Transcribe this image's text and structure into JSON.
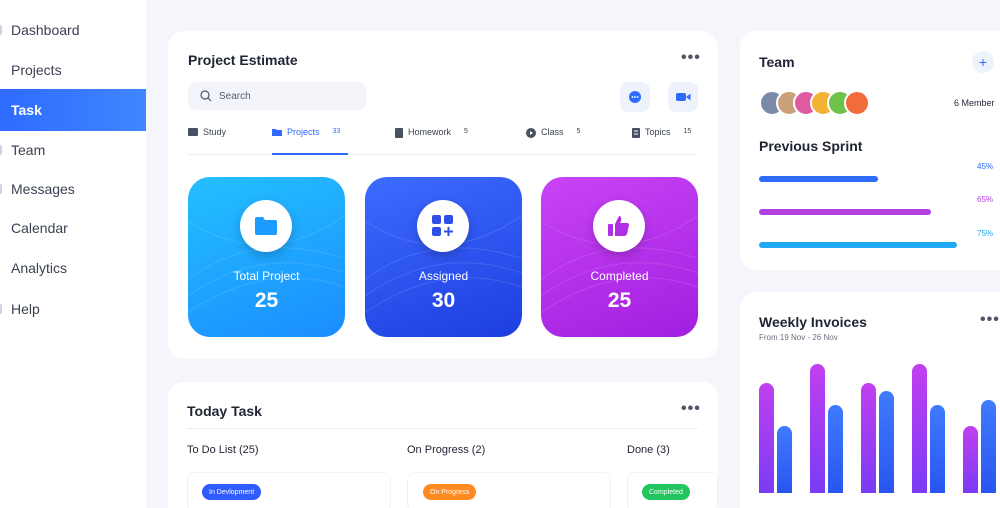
{
  "sidebar": {
    "items": [
      {
        "label": "Dashboard",
        "active": false
      },
      {
        "label": "Projects",
        "active": false
      },
      {
        "label": "Task",
        "active": true
      },
      {
        "label": "Team",
        "active": false
      },
      {
        "label": "Messages",
        "active": false
      },
      {
        "label": "Calendar",
        "active": false
      },
      {
        "label": "Analytics",
        "active": false
      },
      {
        "label": "Help",
        "active": false
      }
    ]
  },
  "project_estimate": {
    "title": "Project Estimate",
    "search_placeholder": "Search",
    "tabs": [
      {
        "label": "Study",
        "count": "",
        "icon": "book-icon"
      },
      {
        "label": "Projects",
        "count": "33",
        "icon": "folder-icon",
        "active": true
      },
      {
        "label": "Homework",
        "count": "5",
        "icon": "document-icon"
      },
      {
        "label": "Class",
        "count": "5",
        "icon": "play-icon"
      },
      {
        "label": "Topics",
        "count": "15",
        "icon": "list-icon"
      }
    ],
    "stats": [
      {
        "label": "Total Project",
        "value": "25",
        "icon": "folder-icon",
        "color_from": "#1fb6ff",
        "color_to": "#1a8dff"
      },
      {
        "label": "Assigned",
        "value": "30",
        "icon": "apps-add-icon",
        "color_from": "#3a63ff",
        "color_to": "#1f3fe0"
      },
      {
        "label": "Completed",
        "value": "25",
        "icon": "thumbs-up-icon",
        "color_from": "#c03cf2",
        "color_to": "#a21fe0"
      }
    ]
  },
  "today_task": {
    "title": "Today Task",
    "columns": [
      {
        "label": "To Do List (25)",
        "badge": "In Devlopment",
        "badge_color": "#2f5bff"
      },
      {
        "label": "On Progress (2)",
        "badge": "On Progress",
        "badge_color": "#ff8a1f"
      },
      {
        "label": "Done (3)",
        "badge": "Completed",
        "badge_color": "#22c55e"
      }
    ]
  },
  "team": {
    "title": "Team",
    "members_label": "6 Member",
    "avatars": [
      "#7a8aa6",
      "#c9a27a",
      "#e05aa0",
      "#f2b233",
      "#6cc24a",
      "#f26b3a"
    ]
  },
  "previous_sprint": {
    "title": "Previous Sprint",
    "items": [
      {
        "label": "45%",
        "value": 0.45,
        "color": "#2f6bff"
      },
      {
        "label": "65%",
        "value": 0.65,
        "color": "#b23fe0"
      },
      {
        "label": "75%",
        "value": 0.75,
        "color": "#1fa9f2"
      }
    ]
  },
  "weekly_invoices": {
    "title": "Weekly Invoices",
    "subtitle": "From 19 Nov - 26 Nov"
  },
  "chart_data": {
    "type": "bar",
    "series": [
      {
        "values": [
          0.85,
          1.0,
          0.85,
          1.0,
          0.52
        ]
      },
      {
        "values": [
          0.52,
          0.68,
          0.79,
          0.68,
          0.72
        ]
      }
    ]
  }
}
